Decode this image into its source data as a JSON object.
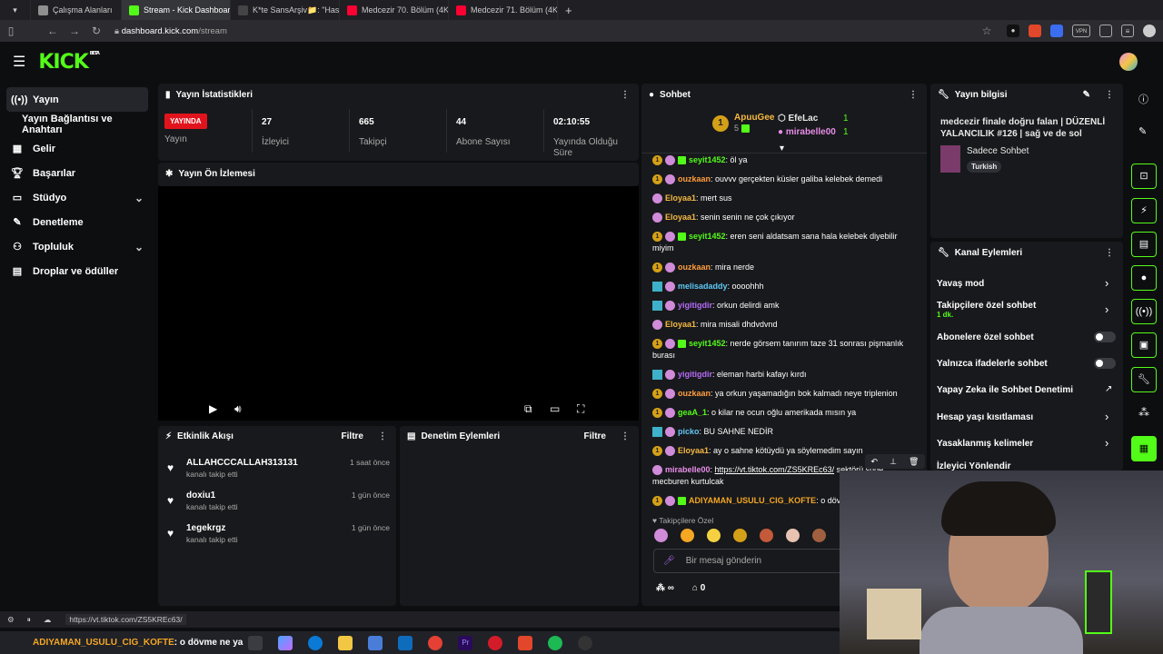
{
  "browser": {
    "tabs": [
      {
        "label": "Çalışma Alanları",
        "color": "#8f8f8f",
        "active": false
      },
      {
        "label": "Stream - Kick Dashboard",
        "color": "#53fc18",
        "active": true
      },
      {
        "label": "K*te SansArşiv📁: \"Hasan A",
        "color": "#444",
        "active": false
      },
      {
        "label": "Medcezir 70. Bölüm (4K) - ",
        "color": "#ff0033",
        "active": false
      },
      {
        "label": "Medcezir 71. Bölüm (4K) - ",
        "color": "#ff0033",
        "active": false
      }
    ],
    "new_tab": "+",
    "url_host": "dashboard.kick.com",
    "url_path": "/stream",
    "url_full": "dashboard.kick.com/stream",
    "vpn": "VPN"
  },
  "kick": {
    "logo": "KICK",
    "beta": "BETA"
  },
  "sidebar": {
    "items": [
      {
        "label": "Yayın",
        "icon": "stream-icon"
      },
      {
        "label": "Yayın Bağlantısı ve Anahtarı",
        "icon": ""
      },
      {
        "label": "Gelir",
        "icon": "revenue-icon"
      },
      {
        "label": "Başarılar",
        "icon": "trophy-icon"
      },
      {
        "label": "Stüdyo",
        "icon": "studio-icon"
      },
      {
        "label": "Denetleme",
        "icon": "moderation-icon"
      },
      {
        "label": "Topluluk",
        "icon": "community-icon"
      },
      {
        "label": "Droplar ve ödüller",
        "icon": "drops-icon"
      }
    ]
  },
  "stats": {
    "title": "Yayın İstatistikleri",
    "live": "YAYINDA",
    "live_label": "Yayın",
    "items": [
      {
        "value": "27",
        "label": "İzleyici"
      },
      {
        "value": "665",
        "label": "Takipçi"
      },
      {
        "value": "44",
        "label": "Abone Sayısı"
      },
      {
        "value": "02:10:55",
        "label": "Yayında Olduğu Süre"
      }
    ]
  },
  "preview": {
    "title": "Yayın Ön İzlemesi"
  },
  "activity": {
    "title": "Etkinlik Akışı",
    "filter": "Filtre",
    "items": [
      {
        "name": "ALLAHCCCALLAH313131",
        "sub": "kanalı takip etti",
        "time": "1 saat önce"
      },
      {
        "name": "doxiu1",
        "sub": "kanalı takip etti",
        "time": "1 gün önce"
      },
      {
        "name": "1egekrgz",
        "sub": "kanalı takip etti",
        "time": "1 gün önce"
      }
    ]
  },
  "modlog": {
    "title": "Denetim Eylemleri",
    "filter": "Filtre"
  },
  "chat": {
    "title": "Sohbet",
    "top": [
      {
        "name": "ApuuGee",
        "count": "5",
        "rank": "1"
      },
      {
        "name": "EfeLac",
        "count": "1"
      },
      {
        "name": "mirabelle00",
        "count": "1"
      }
    ],
    "messages": [
      {
        "user": "seyit1452",
        "color": "#53fc18",
        "badges": [
          "1",
          "av",
          "sub"
        ],
        "text": ": öl ya"
      },
      {
        "user": "ouzkaan",
        "color": "#ff9d3c",
        "badges": [
          "1",
          "av"
        ],
        "text": ": ouvvv gerçekten küsler galiba kelebek demedi"
      },
      {
        "user": "Eloyaa1",
        "color": "#f5b942",
        "badges": [
          "av"
        ],
        "text": ": mert sus"
      },
      {
        "user": "Eloyaa1",
        "color": "#f5b942",
        "badges": [
          "av"
        ],
        "text": ": senin senin ne çok çıkıyor"
      },
      {
        "user": "seyit1452",
        "color": "#53fc18",
        "badges": [
          "1",
          "av",
          "sub"
        ],
        "text": ": eren seni aldatsam sana hala kelebek diyebilir miyim"
      },
      {
        "user": "ouzkaan",
        "color": "#ff9d3c",
        "badges": [
          "1",
          "av"
        ],
        "text": ": mira nerde"
      },
      {
        "user": "melisadaddy",
        "color": "#5ec8f5",
        "badges": [
          "og",
          "av"
        ],
        "text": ": oooohhh"
      },
      {
        "user": "yigitigdir",
        "color": "#b56cf7",
        "badges": [
          "og",
          "av"
        ],
        "text": ": orkun delirdi amk"
      },
      {
        "user": "Eloyaa1",
        "color": "#f5b942",
        "badges": [
          "av"
        ],
        "text": ": mira misali dhdvdvnd"
      },
      {
        "user": "seyit1452",
        "color": "#53fc18",
        "badges": [
          "1",
          "av",
          "sub"
        ],
        "text": ": nerde görsem tanırım taze 31 sonrası pişmanlık burası"
      },
      {
        "user": "yigitigdir",
        "color": "#b56cf7",
        "badges": [
          "og",
          "av"
        ],
        "text": ": eleman harbi kafayı kırdı"
      },
      {
        "user": "ouzkaan",
        "color": "#ff9d3c",
        "badges": [
          "1",
          "av"
        ],
        "text": ": ya orkun yaşamadığın bok kalmadı neye triplenion"
      },
      {
        "user": "geaA_1",
        "color": "#53fc18",
        "badges": [
          "1",
          "av"
        ],
        "text": ": o kilar ne ocun oğlu amerikada mısın ya"
      },
      {
        "user": "picko",
        "color": "#5ec8f5",
        "badges": [
          "og",
          "av"
        ],
        "text": ": BU SAHNE NEDİR"
      },
      {
        "user": "Eloyaa1",
        "color": "#f5b942",
        "badges": [
          "1",
          "av"
        ],
        "text": ": ay o sahne kötüydü ya söylemedim sayın"
      },
      {
        "user": "mirabelle00",
        "color": "#e88de8",
        "badges": [
          "av"
        ],
        "text": ": ",
        "link": "https://vt.tiktok.com/ZS5KREc63/",
        "after": " sektörü sude mecburen kurtulcak"
      },
      {
        "user": "ADIYAMAN_USULU_CIG_KOFTE",
        "color": "#f5a623",
        "badges": [
          "1",
          "av",
          "sub"
        ],
        "text": ": o döv"
      }
    ],
    "followers_only": "Takipçilere Özel",
    "placeholder": "Bir mesaj gönderin",
    "infinite": "∞",
    "count": "0"
  },
  "info": {
    "title": "Yayın bilgisi",
    "stream_title": "medcezir finale doğru falan | DÜZENLİ YALANCILIK #126 | sağ ve de sol",
    "category": "Sadece Sohbet",
    "tag": "Turkish"
  },
  "actions": {
    "title": "Kanal Eylemleri",
    "items": [
      {
        "label": "Yavaş mod",
        "kind": "arrow"
      },
      {
        "label": "Takipçilere özel sohbet",
        "sub": "1 dk.",
        "kind": "arrow"
      },
      {
        "label": "Abonelere özel sohbet",
        "kind": "toggle"
      },
      {
        "label": "Yalnızca ifadelerle sohbet",
        "kind": "toggle"
      },
      {
        "label": "Yapay Zeka ile Sohbet Denetimi",
        "kind": "external"
      },
      {
        "label": "Hesap yaşı kısıtlaması",
        "kind": "arrow"
      },
      {
        "label": "Yasaklanmış kelimeler",
        "kind": "arrow"
      },
      {
        "label": "İzleyici Yönlendir",
        "kind": "none"
      }
    ]
  },
  "statusbar": {
    "url": "https://vt.tiktok.com/ZS5KREc63/"
  },
  "overlay": {
    "user": "ADIYAMAN_USULU_CIG_KOFTE",
    "text": ": o dövme ne ya"
  }
}
